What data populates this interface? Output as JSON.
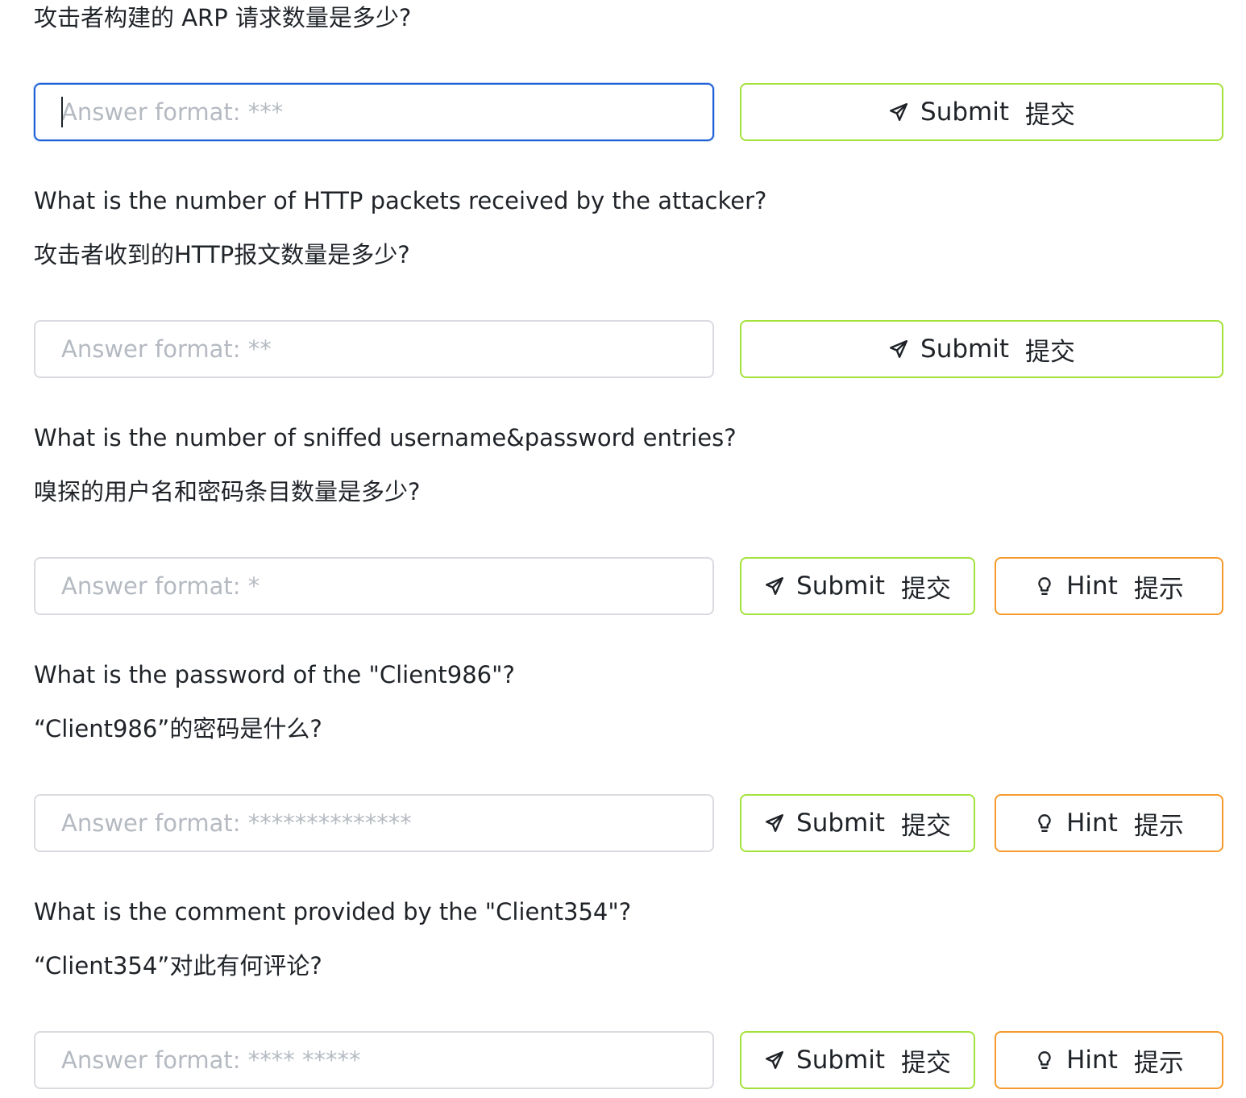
{
  "questions": [
    {
      "text_en": "",
      "text_zh": "攻击者构建的 ARP 请求数量是多少?",
      "placeholder": "Answer format: ***",
      "submit_label": "Submit",
      "submit_label_zh": "提交",
      "has_hint": false
    },
    {
      "text_en": "What is the number of HTTP packets received by the attacker?",
      "text_zh": "攻击者收到的HTTP报文数量是多少?",
      "placeholder": "Answer format: **",
      "submit_label": "Submit",
      "submit_label_zh": "提交",
      "has_hint": false
    },
    {
      "text_en": "What is the number of sniffed username&password entries?",
      "text_zh": "嗅探的用户名和密码条目数量是多少?",
      "placeholder": "Answer format: *",
      "submit_label": "Submit",
      "submit_label_zh": "提交",
      "hint_label": "Hint",
      "hint_label_zh": "提示",
      "has_hint": true
    },
    {
      "text_en": "What is the password of the \"Client986\"?",
      "text_zh": "“Client986”的密码是什么?",
      "placeholder": "Answer format: **************",
      "submit_label": "Submit",
      "submit_label_zh": "提交",
      "hint_label": "Hint",
      "hint_label_zh": "提示",
      "has_hint": true
    },
    {
      "text_en": "What is the comment provided by the \"Client354\"?",
      "text_zh": "“Client354”对此有何评论?",
      "placeholder": "Answer format: **** *****",
      "submit_label": "Submit",
      "submit_label_zh": "提交",
      "hint_label": "Hint",
      "hint_label_zh": "提示",
      "has_hint": true
    }
  ],
  "icons": {
    "submit": "send-icon",
    "hint": "lightbulb-icon"
  },
  "colors": {
    "submit_border": "#a3e23a",
    "hint_border": "#f59a2c",
    "focus_border": "#1d5fd6",
    "input_border": "#d9dbe0",
    "placeholder": "#b5bac2"
  }
}
